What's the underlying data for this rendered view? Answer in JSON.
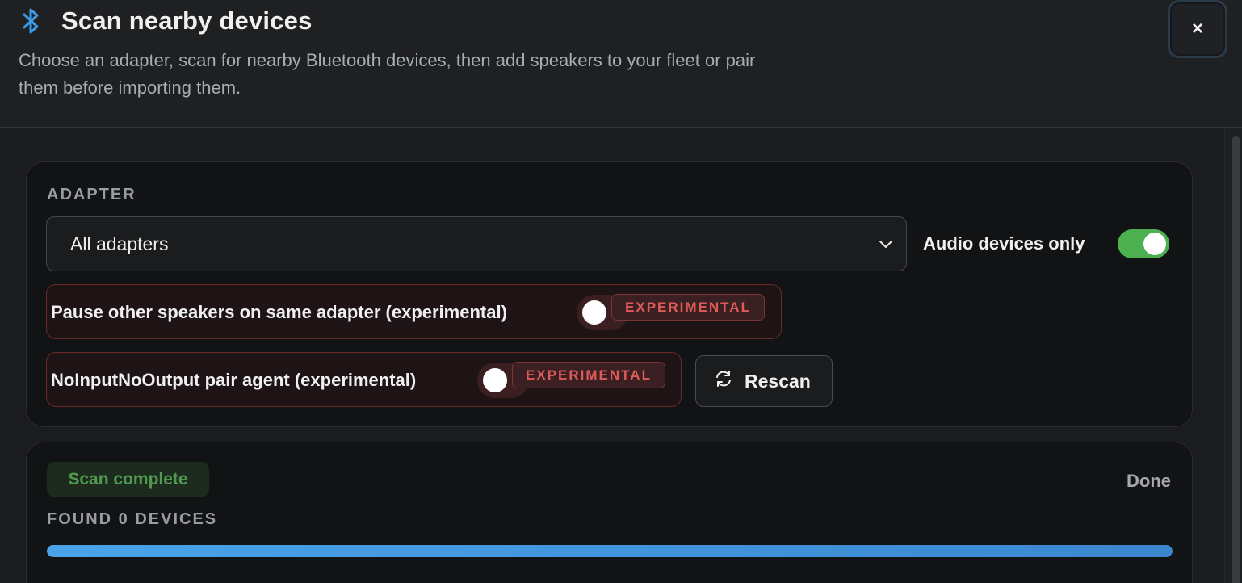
{
  "header": {
    "title": "Scan nearby devices",
    "subtitle": "Choose an adapter, scan for nearby Bluetooth devices, then add speakers to your fleet or pair them before importing them.",
    "close_label": "×",
    "icon": "bluetooth-icon"
  },
  "adapter": {
    "label": "ADAPTER",
    "selected": "All adapters",
    "audio_only_label": "Audio devices only",
    "audio_only_enabled": true
  },
  "options": {
    "pause_label": "Pause other speakers on same adapter (experimental)",
    "pause_enabled": false,
    "noio_label": "NoInputNoOutput pair agent (experimental)",
    "noio_enabled": false,
    "experimental_badge": "EXPERIMENTAL",
    "rescan_label": "Rescan"
  },
  "scan": {
    "status": "Scan complete",
    "state": "Done",
    "found_label": "FOUND 0 DEVICES",
    "progress_percent": 100
  },
  "colors": {
    "accent": "#4aa3e8",
    "toggle_on": "#4caf50",
    "experimental": "#e05a58",
    "status_ok": "#4f9a4f"
  }
}
